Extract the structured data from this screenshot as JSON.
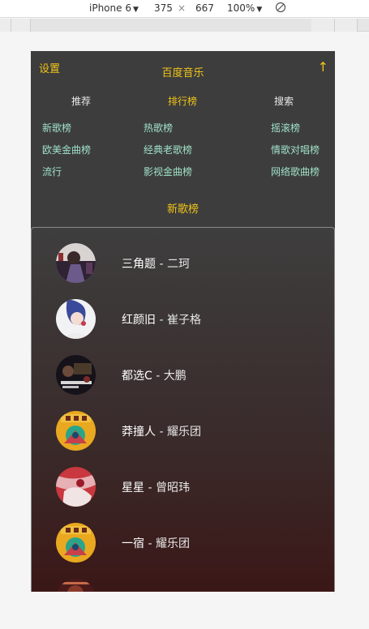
{
  "devtools": {
    "device": "iPhone 6",
    "width": "375",
    "times": "×",
    "height": "667",
    "zoom": "100%"
  },
  "header": {
    "settings": "设置",
    "title": "百度音乐",
    "up_arrow": "↑"
  },
  "tabs": [
    {
      "label": "推荐",
      "active": false
    },
    {
      "label": "排行榜",
      "active": true
    },
    {
      "label": "搜索",
      "active": false
    }
  ],
  "charts": [
    [
      "新歌榜",
      "热歌榜",
      "摇滚榜"
    ],
    [
      "欧美金曲榜",
      "经典老歌榜",
      "情歌对唱榜"
    ],
    [
      "流行",
      "影视金曲榜",
      "网络歌曲榜"
    ]
  ],
  "section_title": "新歌榜",
  "songs": [
    {
      "title": "三角题",
      "artist": "二珂"
    },
    {
      "title": "红颜旧",
      "artist": "崔子格"
    },
    {
      "title": "都选C",
      "artist": "大鹏"
    },
    {
      "title": "莽撞人",
      "artist": "耀乐团"
    },
    {
      "title": "星星",
      "artist": "曾昭玮"
    },
    {
      "title": "一宿",
      "artist": "耀乐团"
    }
  ],
  "separator": " - "
}
